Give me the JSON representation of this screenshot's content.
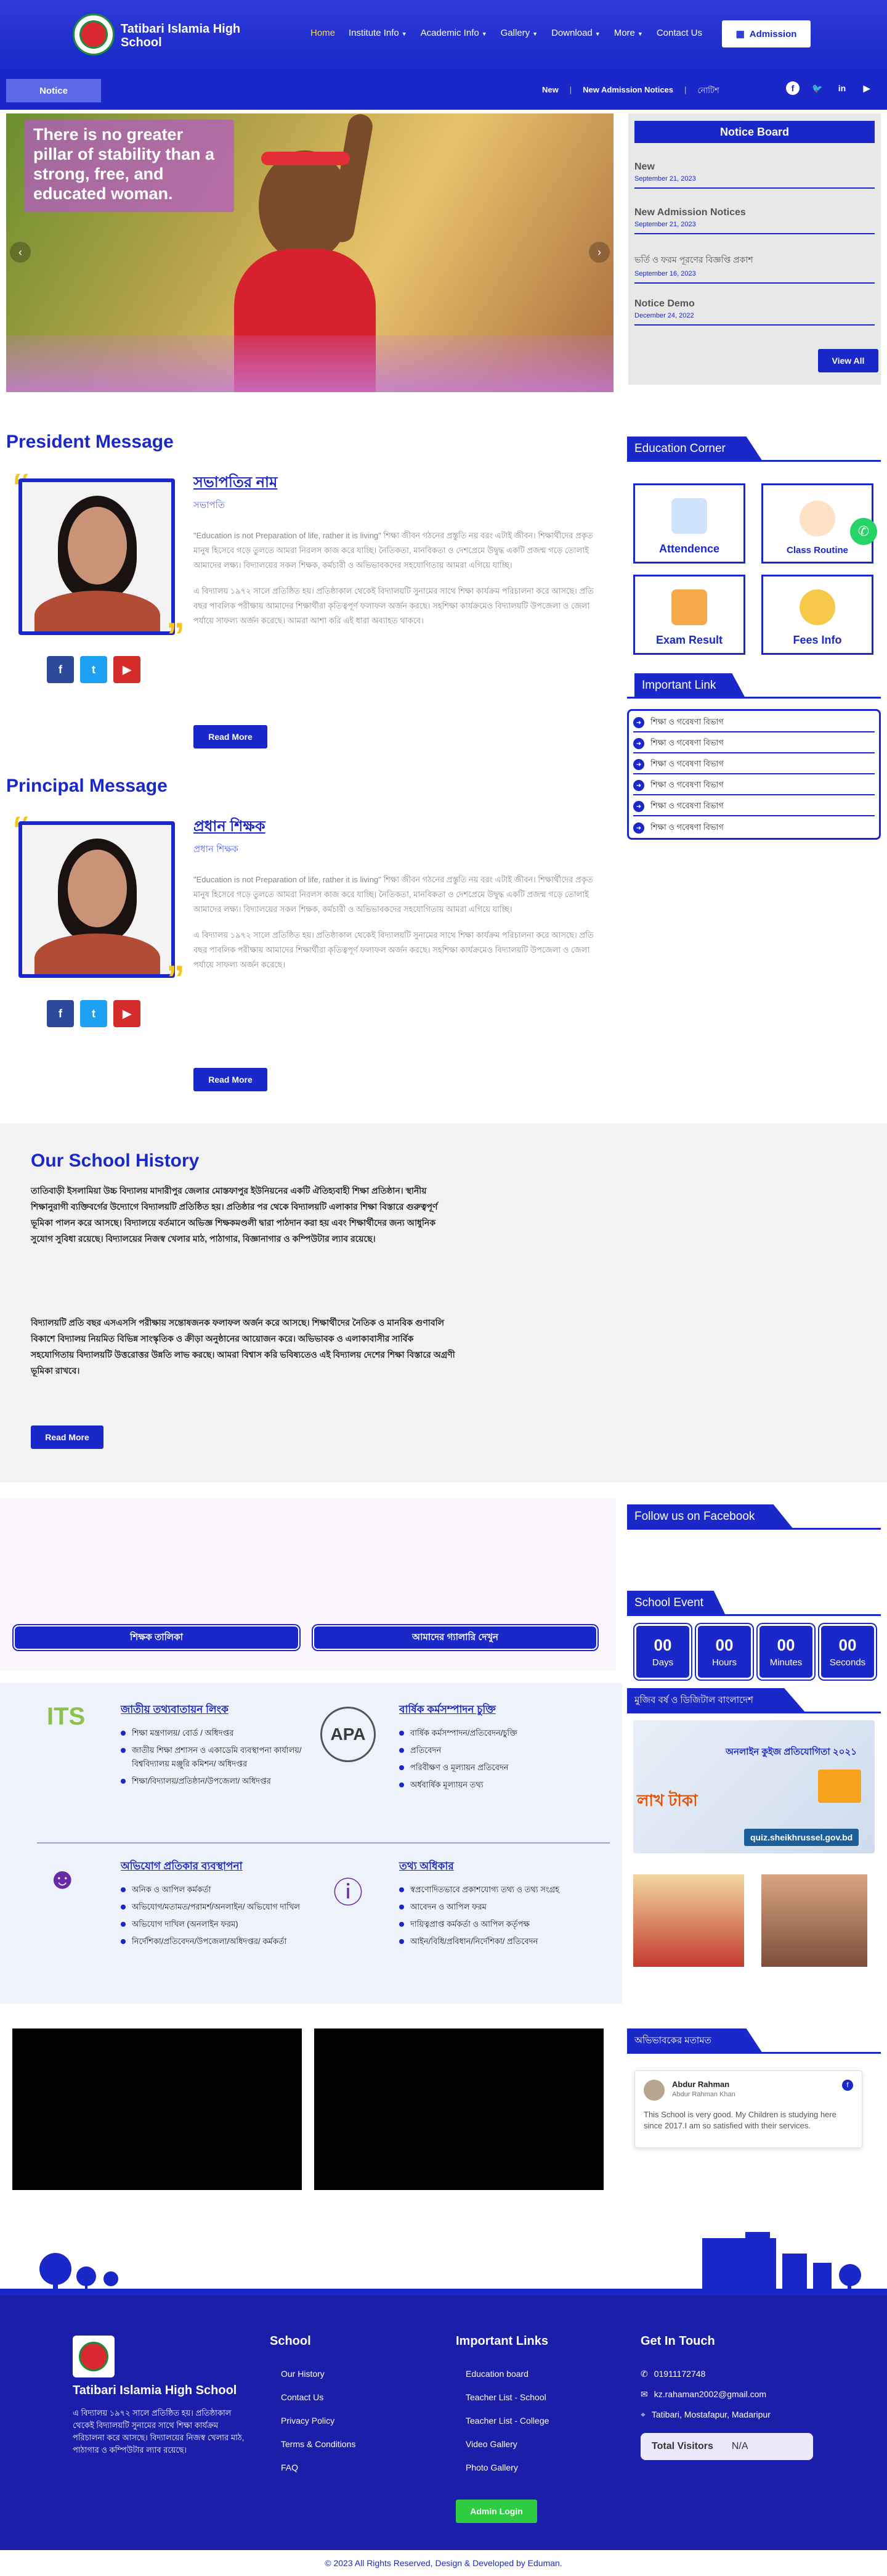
{
  "header": {
    "brand": "Tatibari Islamia High School",
    "nav": [
      {
        "label": "Home",
        "active": true
      },
      {
        "label": "Institute Info",
        "caret": true
      },
      {
        "label": "Academic Info",
        "caret": true
      },
      {
        "label": "Gallery",
        "caret": true
      },
      {
        "label": "Download",
        "caret": true
      },
      {
        "label": "More",
        "caret": true
      },
      {
        "label": "Contact Us"
      }
    ],
    "admission_label": "Admission"
  },
  "noticebar": {
    "label": "Notice",
    "ticker": [
      "New",
      "New Admission Notices",
      "নোটিশ"
    ]
  },
  "hero": {
    "quote": "There is no greater pillar of stability than a strong, free, and educated woman."
  },
  "notice_board": {
    "title": "Notice Board",
    "items": [
      {
        "title": "New",
        "date": "September 21, 2023"
      },
      {
        "title": "New Admission Notices",
        "date": "September 21, 2023"
      },
      {
        "title": "ভর্তি ও ফরম পূরণের বিজ্ঞপ্তি প্রকাশ",
        "date": "September 16, 2023"
      },
      {
        "title": "Notice Demo",
        "date": "December 24, 2022"
      }
    ],
    "view_all": "View All"
  },
  "president": {
    "section_title": "President Message",
    "name": "সভাপতির নাম",
    "role": "সভাপতি",
    "p1": "\"Education is not Preparation of life, rather it is living\" শিক্ষা জীবন গঠনের প্রস্তুতি নয় বরং এটাই জীবন। শিক্ষার্থীদের প্রকৃত মানুষ হিসেবে গড়ে তুলতে আমরা নিরলস কাজ করে যাচ্ছি। নৈতিকতা, মানবিকতা ও দেশপ্রেমে উদ্বুদ্ধ একটি প্রজন্ম গড়ে তোলাই আমাদের লক্ষ্য। বিদ্যালয়ের সকল শিক্ষক, কর্মচারী ও অভিভাবকদের সহযোগিতায় আমরা এগিয়ে যাচ্ছি।",
    "p2": "এ বিদ্যালয় ১৯৭২ সালে প্রতিষ্ঠিত হয়। প্রতিষ্ঠাকাল থেকেই বিদ্যালয়টি সুনামের সাথে শিক্ষা কার্যক্রম পরিচালনা করে আসছে। প্রতি বছর পাবলিক পরীক্ষায় আমাদের শিক্ষার্থীরা কৃতিত্বপূর্ণ ফলাফল অর্জন করছে। সহশিক্ষা কার্যক্রমেও বিদ্যালয়টি উপজেলা ও জেলা পর্যায়ে সাফল্য অর্জন করেছে। আমরা আশা করি এই ধারা অব্যাহত থাকবে।",
    "read_more": "Read More"
  },
  "principal": {
    "section_title": "Principal Message",
    "name": "প্রধান শিক্ষক",
    "role": "প্রধান শিক্ষক",
    "p1": "\"Education is not Preparation of life, rather it is living\" শিক্ষা জীবন গঠনের প্রস্তুতি নয় বরং এটাই জীবন। শিক্ষার্থীদের প্রকৃত মানুষ হিসেবে গড়ে তুলতে আমরা নিরলস কাজ করে যাচ্ছি। নৈতিকতা, মানবিকতা ও দেশপ্রেমে উদ্বুদ্ধ একটি প্রজন্ম গড়ে তোলাই আমাদের লক্ষ্য। বিদ্যালয়ের সকল শিক্ষক, কর্মচারী ও অভিভাবকদের সহযোগিতায় আমরা এগিয়ে যাচ্ছি।",
    "p2": "এ বিদ্যালয় ১৯৭২ সালে প্রতিষ্ঠিত হয়। প্রতিষ্ঠাকাল থেকেই বিদ্যালয়টি সুনামের সাথে শিক্ষা কার্যক্রম পরিচালনা করে আসছে। প্রতি বছর পাবলিক পরীক্ষায় আমাদের শিক্ষার্থীরা কৃতিত্বপূর্ণ ফলাফল অর্জন করছে। সহশিক্ষা কার্যক্রমেও বিদ্যালয়টি উপজেলা ও জেলা পর্যায়ে সাফল্য অর্জন করেছে।",
    "read_more": "Read More"
  },
  "education_corner": {
    "title": "Education Corner",
    "cards": [
      "Attendence",
      "Class Routine",
      "Exam Result",
      "Fees Info"
    ]
  },
  "important_link": {
    "title": "Important Link",
    "items": [
      "শিক্ষা ও গবেষণা বিভাগ",
      "শিক্ষা ও গবেষণা বিভাগ",
      "শিক্ষা ও গবেষণা বিভাগ",
      "শিক্ষা ও গবেষণা বিভাগ",
      "শিক্ষা ও গবেষণা বিভাগ",
      "শিক্ষা ও গবেষণা বিভাগ"
    ]
  },
  "history": {
    "title": "Our School History",
    "p1": "তাতিবাড়ী ইসলামিয়া উচ্চ বিদ্যালয় মাদারীপুর জেলার মোস্তফাপুর ইউনিয়নের একটি ঐতিহ্যবাহী শিক্ষা প্রতিষ্ঠান। স্থানীয় শিক্ষানুরাগী ব্যক্তিবর্গের উদ্যোগে বিদ্যালয়টি প্রতিষ্ঠিত হয়। প্রতিষ্ঠার পর থেকে বিদ্যালয়টি এলাকার শিক্ষা বিস্তারে গুরুত্বপূর্ণ ভূমিকা পালন করে আসছে। বিদ্যালয়ে বর্তমানে অভিজ্ঞ শিক্ষকমণ্ডলী দ্বারা পাঠদান করা হয় এবং শিক্ষার্থীদের জন্য আধুনিক সুযোগ সুবিধা রয়েছে। বিদ্যালয়ের নিজস্ব খেলার মাঠ, পাঠাগার, বিজ্ঞানাগার ও কম্পিউটার ল্যাব রয়েছে।",
    "p2": "বিদ্যালয়টি প্রতি বছর এসএসসি পরীক্ষায় সন্তোষজনক ফলাফল অর্জন করে আসছে। শিক্ষার্থীদের নৈতিক ও মানবিক গুণাবলি বিকাশে বিদ্যালয় নিয়মিত বিভিন্ন সাংস্কৃতিক ও ক্রীড়া অনুষ্ঠানের আয়োজন করে। অভিভাবক ও এলাকাবাসীর সার্বিক সহযোগিতায় বিদ্যালয়টি উত্তরোত্তর উন্নতি লাভ করছে। আমরা বিশ্বাস করি ভবিষ্যতেও এই বিদ্যালয় দেশের শিক্ষা বিস্তারে অগ্রণী ভূমিকা রাখবে।",
    "read_more": "Read More"
  },
  "facebook": {
    "title": "Follow us on Facebook"
  },
  "buttons_row": [
    "শিক্ষক তালিকা",
    "আমাদের গ্যালারি দেখুন"
  ],
  "school_event": {
    "title": "School Event",
    "countdown": [
      {
        "value": "00",
        "label": "Days"
      },
      {
        "value": "00",
        "label": "Hours"
      },
      {
        "value": "00",
        "label": "Minutes"
      },
      {
        "value": "00",
        "label": "Seconds"
      }
    ]
  },
  "services": [
    {
      "title": "জাতীয় তথ্যবাতায়ন লিংক",
      "items": [
        "শিক্ষা মন্ত্রণালয়/ বোর্ড / অধিদপ্তর",
        "জাতীয় শিক্ষা প্রশাসন ও একাডেমি ব্যবস্থাপনা কার্যালয়/বিশ্ববিদ্যালয় মঞ্জুরি কমিশন/ অধিদপ্তর",
        "শিক্ষা/বিদ্যালয়/প্রতিষ্ঠান/উপজেলা/ অধিদপ্তর"
      ]
    },
    {
      "title": "বার্ষিক কর্মসম্পাদন চুক্তি",
      "items": [
        "বার্ষিক কর্মসম্পাদন/প্রতিবেদন/চুক্তি",
        "প্রতিবেদন",
        "পরিবীক্ষণ ও মূল্যায়ন প্রতিবেদন",
        "অর্ধবার্ষিক মূল্যায়ন তথ্য"
      ]
    },
    {
      "title": "অভিযোগ প্রতিকার ব্যবস্থাপনা",
      "items": [
        "অনিক ও আপিল কর্মকর্তা",
        "অভিযোগ/মতামত/পরামর্শ/অনলাইন/ অভিযোগ দাখিল",
        "অভিযোগ দাখিল (অনলাইন ফরম)",
        "নির্দেশিকা/প্রতিবেদন/উপজেলা/অধিদপ্তর/ কর্মকর্তা"
      ]
    },
    {
      "title": "তথ্য অধিকার",
      "items": [
        "স্বপ্রণোদিতভাবে প্রকাশযোগ্য তথ্য ও তথ্য সংগ্রহ",
        "আবেদন ও আপিল ফরম",
        "দায়িত্বপ্রাপ্ত কর্মকর্তা ও আপিল কর্তৃপক্ষ",
        "আইন/বিধি/প্রবিধান/নির্দেশিকা/ প্রতিবেদন"
      ]
    }
  ],
  "national_corner": {
    "title": "মুজিব বর্ষ ও ডিজিটাল বাংলাদেশ",
    "quiz_label": "অনলাইন কুইজ প্রতিযোগিতা ২০২১",
    "quiz_url": "quiz.sheikhrussel.gov.bd",
    "prize_label": "লাখ টাকা"
  },
  "testimonial": {
    "title": "অভিভাবকের মতামত",
    "name": "Abdur Rahman",
    "sub": "Abdur Rahman Khan",
    "text": "This School is very good. My Children is studying here since 2017.I am so satisfied with their services."
  },
  "footer": {
    "brand": "Tatibari Islamia High School",
    "about": "এ বিদ্যালয় ১৯৭২ সালে প্রতিষ্ঠিত হয়। প্রতিষ্ঠাকাল থেকেই বিদ্যালয়টি সুনামের সাথে শিক্ষা কার্যক্রম পরিচালনা করে আসছে। বিদ্যালয়ের নিজস্ব খেলার মাঠ, পাঠাগার ও কম্পিউটার ল্যাব রয়েছে।",
    "school": {
      "title": "School",
      "links": [
        "Our History",
        "Contact Us",
        "Privacy Policy",
        "Terms & Conditions",
        "FAQ"
      ]
    },
    "important": {
      "title": "Important Links",
      "links": [
        "Education board",
        "Teacher List - School",
        "Teacher List - College",
        "Video Gallery",
        "Photo Gallery"
      ]
    },
    "contact": {
      "title": "Get In Touch",
      "phone": "01911172748",
      "email": "kz.rahaman2002@gmail.com",
      "address": "Tatibari, Mostafapur, Madaripur"
    },
    "visitors_label": "Total Visitors",
    "visitors_value": "N/A",
    "admin_login": "Admin Login"
  },
  "copyright": "© 2023 All Rights Reserved, Design & Developed by Eduman.",
  "colors": {
    "primary": "#1b28c9",
    "accent": "#f5c518",
    "footer": "#1b1ea8"
  }
}
